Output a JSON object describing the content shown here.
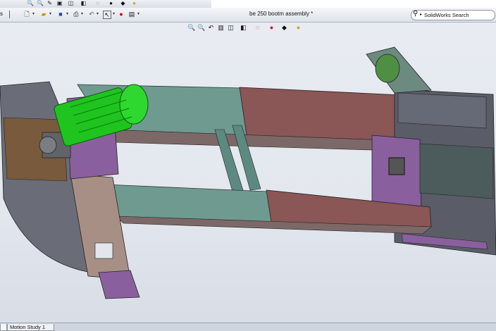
{
  "window": {
    "document_title": "be 250 bootm assembly *"
  },
  "search": {
    "label": "SolidWorks Search"
  },
  "tabs": {
    "left_stub": "s",
    "motion_study": "Motion Study 1"
  },
  "top_toolbar": {
    "icons": [
      "zoom-icon",
      "zoom-area-icon",
      "sketch-icon",
      "view-icon",
      "view-orient-icon",
      "display-icon",
      "hide-icon",
      "edit-appearance-icon",
      "scene-icon",
      "dropdown-icon"
    ]
  },
  "quick_access": {
    "icons": [
      "new-file-icon",
      "open-folder-icon",
      "save-icon",
      "print-icon",
      "undo-icon",
      "select-icon",
      "rebuild-icon",
      "options-icon"
    ]
  },
  "view_toolbar": {
    "icons": [
      "zoom-to-fit-icon",
      "zoom-to-area-icon",
      "previous-view-icon",
      "section-view-icon",
      "view-orientation-icon",
      "display-style-icon",
      "hide-show-icon",
      "edit-appearance-icon",
      "apply-scene-icon"
    ]
  },
  "colors": {
    "accent": "#1f4fa8",
    "motor": "#1fc41f",
    "frame": "#5d8a80",
    "housing": "#7a4a4a"
  }
}
